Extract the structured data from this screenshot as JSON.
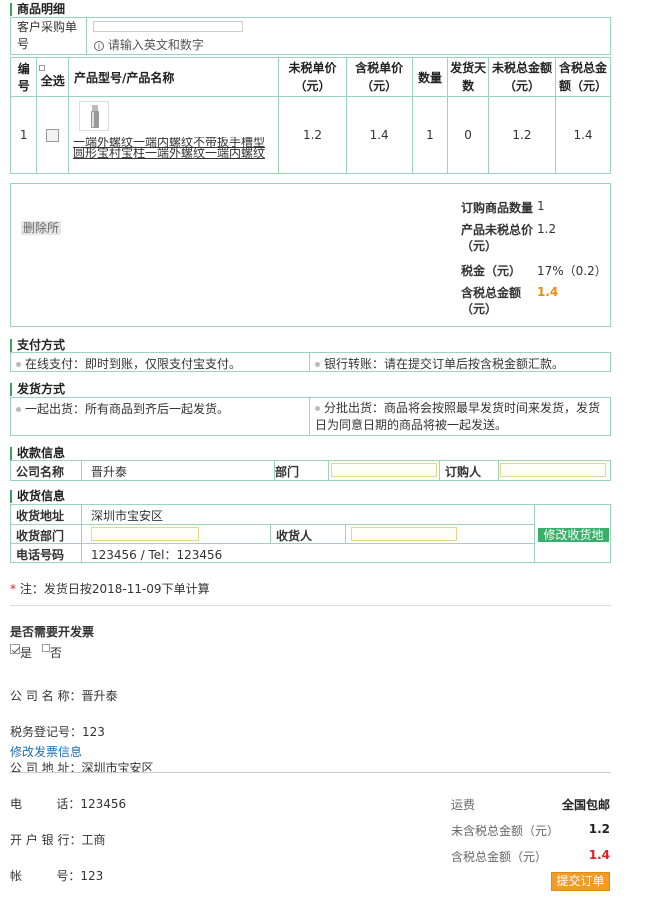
{
  "product_section": {
    "title": "商品明细",
    "customer_po_label": "客户采购单号",
    "customer_po_value": "",
    "customer_po_hint": "请输入英文和数字"
  },
  "product_table": {
    "headers": {
      "index": "编号",
      "select_all": "全选",
      "model_name": "产品型号/产品名称",
      "unit_price_ex_tax": "未税单价（元）",
      "unit_price_inc_tax": "含税单价（元）",
      "quantity": "数量",
      "ship_days": "发货天数",
      "total_ex_tax": "未税总金额（元）",
      "total_inc_tax": "含税总金额（元）"
    },
    "rows": [
      {
        "index": "1",
        "name_line1": "一端外螺纹一端内螺纹不带扳手槽型圆形宝村宝柱一端外螺纹一端内螺纹不带扳手槽型",
        "unit_price_ex_tax": "1.2",
        "unit_price_inc_tax": "1.4",
        "quantity": "1",
        "ship_days": "0",
        "total_ex_tax": "1.2",
        "total_inc_tax": "1.4"
      }
    ]
  },
  "summary": {
    "delete_label": "删除所",
    "qty_label": "订购商品数量",
    "qty_value": "1",
    "ex_tax_total_label": "产品未税总价（元）",
    "ex_tax_total_value": "1.2",
    "tax_label": "税金（元）",
    "tax_value": "17%（0.2）",
    "inc_tax_total_label": "含税总金额（元）",
    "inc_tax_total_value": "1.4"
  },
  "payment": {
    "title": "支付方式",
    "online": "在线支付：即时到账，仅限支付宝支付。",
    "bank": "银行转账：请在提交订单后按含税金额汇款。"
  },
  "delivery": {
    "title": "发货方式",
    "together": "一起出货：所有商品到齐后一起发货。",
    "split": "分批出货：商品将会按照最早发货时间来发货，发货日为同意日期的商品将被一起发送。"
  },
  "billing": {
    "title": "收款信息",
    "company_label": "公司名称",
    "company_value": "晋升泰",
    "dept_label": "部门",
    "orderer_label": "订购人"
  },
  "shipping": {
    "title": "收货信息",
    "address_label": "收货地址",
    "address_value": "深圳市宝安区",
    "dept_label": "收货部门",
    "receiver_label": "收货人",
    "phone_label": "电话号码",
    "phone_value": "123456 / Tel：123456",
    "edit_address_button": "修改收货地"
  },
  "note": {
    "star": "*",
    "text": "注：发货日按2018-11-09下单计算"
  },
  "invoice": {
    "title": "是否需要开发票",
    "yes_label": "是",
    "no_label": "否",
    "company_line": "公 司 名 称：晋升泰",
    "tax_no_line": "税务登记号：123",
    "address_line": "公 司 地 址：深圳市宝安区",
    "phone_line": "电         话：123456",
    "bank_line": "开 户 银 行：工商",
    "account_line": "帐         号：123",
    "edit_link": "修改发票信息"
  },
  "totals": {
    "shipping_label": "运费",
    "shipping_value": "全国包邮",
    "ex_tax_label": "未含税总金额（元）",
    "ex_tax_value": "1.2",
    "inc_tax_label": "含税总金额（元）",
    "inc_tax_value": "1.4",
    "submit_button": "提交订单"
  },
  "colors": {
    "accent_green": "#3aaf6a",
    "border_green": "#9fd3b7",
    "orange": "#f39c25",
    "red": "#e02020"
  }
}
